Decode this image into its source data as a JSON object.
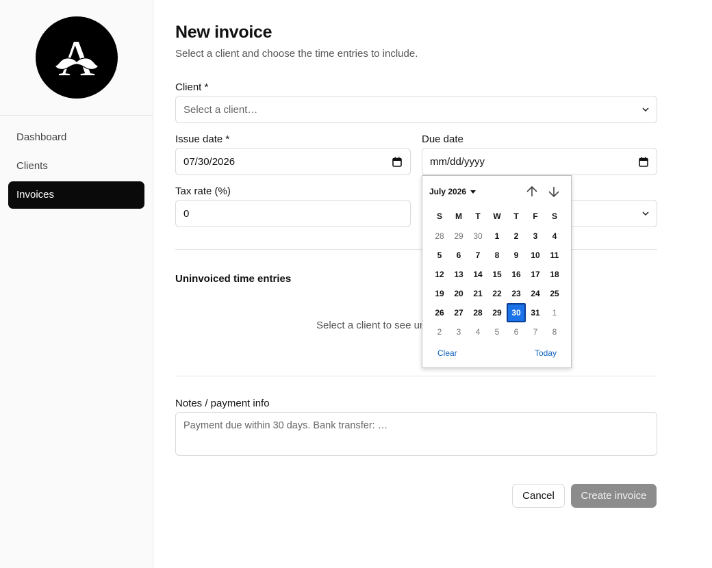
{
  "sidebar": {
    "logo_letter": "A",
    "items": [
      {
        "label": "Dashboard",
        "active": false
      },
      {
        "label": "Clients",
        "active": false
      },
      {
        "label": "Invoices",
        "active": true
      }
    ]
  },
  "page": {
    "title": "New invoice",
    "subtitle": "Select a client and choose the time entries to include."
  },
  "form": {
    "client_label": "Client *",
    "client_placeholder": "Select a client…",
    "issue_date_label": "Issue date *",
    "issue_date_value": "07/30/2026",
    "due_date_label": "Due date",
    "due_date_placeholder": "mm/dd/yyyy",
    "tax_rate_label": "Tax rate (%)",
    "tax_rate_value": "0"
  },
  "entries": {
    "title": "Uninvoiced time entries",
    "empty_message": "Select a client to see un"
  },
  "notes": {
    "label": "Notes / payment info",
    "placeholder": "Payment due within 30 days. Bank transfer: …"
  },
  "actions": {
    "cancel_label": "Cancel",
    "create_label": "Create invoice"
  },
  "datepicker": {
    "month_label": "July 2026",
    "weekdays": [
      "S",
      "M",
      "T",
      "W",
      "T",
      "F",
      "S"
    ],
    "weeks": [
      [
        "28",
        "29",
        "30",
        "1",
        "2",
        "3",
        "4"
      ],
      [
        "5",
        "6",
        "7",
        "8",
        "9",
        "10",
        "11"
      ],
      [
        "12",
        "13",
        "14",
        "15",
        "16",
        "17",
        "18"
      ],
      [
        "19",
        "20",
        "21",
        "22",
        "23",
        "24",
        "25"
      ],
      [
        "26",
        "27",
        "28",
        "29",
        "30",
        "31",
        "1"
      ],
      [
        "2",
        "3",
        "4",
        "5",
        "6",
        "7",
        "8"
      ]
    ],
    "clear_label": "Clear",
    "today_label": "Today",
    "selected_day": "30",
    "accent": "#1a73e8"
  }
}
